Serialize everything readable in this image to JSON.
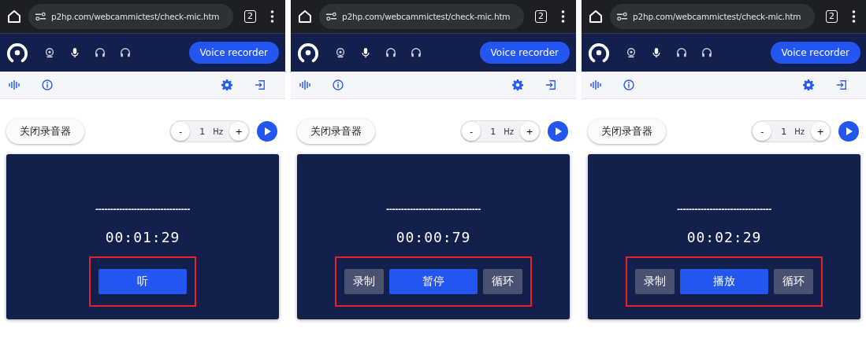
{
  "panels": [
    {
      "url": "p2hp.com/webcammictest/check-mic.htm",
      "tab_count": "2",
      "nav_button": "Voice recorder",
      "close_button": "关闭录音器",
      "stepper": {
        "minus": "-",
        "value": "1",
        "unit": "Hz",
        "plus": "+"
      },
      "dashes": "--------------------------------",
      "time": "00:01:29",
      "highlighted": true,
      "buttons": [
        {
          "label": "听",
          "kind": "primary"
        }
      ]
    },
    {
      "url": "p2hp.com/webcammictest/check-mic.htm",
      "tab_count": "2",
      "nav_button": "Voice recorder",
      "close_button": "关闭录音器",
      "stepper": {
        "minus": "-",
        "value": "1",
        "unit": "Hz",
        "plus": "+"
      },
      "dashes": "--------------------------------",
      "time": "00:00:79",
      "highlighted": true,
      "buttons": [
        {
          "label": "录制",
          "kind": "secondary"
        },
        {
          "label": "暂停",
          "kind": "primary"
        },
        {
          "label": "循环",
          "kind": "secondary"
        }
      ]
    },
    {
      "url": "p2hp.com/webcammictest/check-mic.htm",
      "tab_count": "2",
      "nav_button": "Voice recorder",
      "close_button": "关闭录音器",
      "stepper": {
        "minus": "-",
        "value": "1",
        "unit": "Hz",
        "plus": "+"
      },
      "dashes": "--------------------------------",
      "time": "00:02:29",
      "highlighted": true,
      "buttons": [
        {
          "label": "录制",
          "kind": "secondary"
        },
        {
          "label": "播放",
          "kind": "primary"
        },
        {
          "label": "循环",
          "kind": "secondary"
        }
      ]
    }
  ]
}
